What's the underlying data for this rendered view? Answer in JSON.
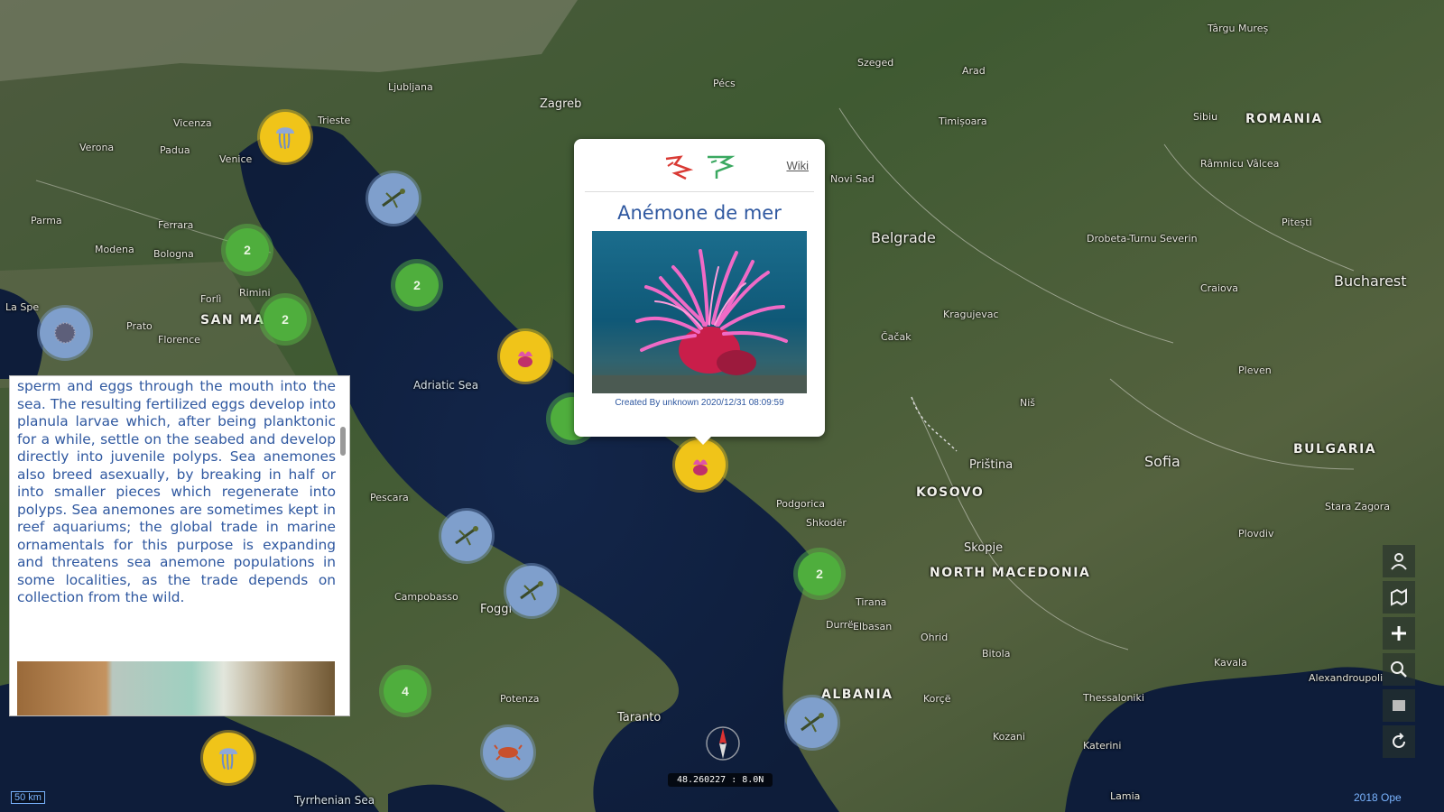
{
  "map": {
    "labels": {
      "countries": [
        "ROMANIA",
        "SAN MA",
        "KOSOVO",
        "NORTH MACEDONIA",
        "BULGARIA",
        "ALBANIA"
      ],
      "seas": [
        "Adriatic Sea",
        "Tyrrhenian Sea"
      ],
      "cities": [
        "Trieste",
        "Ljubljana",
        "Zagreb",
        "Vicenza",
        "Verona",
        "Padua",
        "Venice",
        "Parma",
        "Ferrara",
        "Modena",
        "Bologna",
        "Forlì",
        "Rimini",
        "Prato",
        "Florence",
        "La Spe",
        "Pescara",
        "Campobasso",
        "Foggi",
        "Taranto",
        "Potenza",
        "Durrës",
        "Tirana",
        "Elbasan",
        "Podgorica",
        "Shkodër",
        "Skopje",
        "Priština",
        "Sofia",
        "Belgrade",
        "Novi Sad",
        "Čačak",
        "Kragujevac",
        "Niš",
        "Craiova",
        "Bucharest",
        "Pitești",
        "Stara Zagora",
        "Plovdiv",
        "Kavala",
        "Alexandroupoli",
        "Thessaloniki",
        "Kozani",
        "Katerini",
        "Lamia",
        "Korçë",
        "Ohrid",
        "Bitola",
        "Drobeta-Turnu Severin",
        "Szeged",
        "Arad",
        "Timișoara",
        "Sibiu",
        "Râmnicu Vâlcea",
        "Târgu Mureș",
        "Pleven",
        "Pécs"
      ]
    },
    "clusters": [
      {
        "count": "2"
      },
      {
        "count": "2"
      },
      {
        "count": "2"
      },
      {
        "count": "2"
      },
      {
        "count": "4"
      }
    ],
    "markers": [
      {
        "icon": "jellyfish-icon",
        "color": "#f0c419"
      },
      {
        "icon": "lobster-icon",
        "color": "#7f9fcc"
      },
      {
        "icon": "sea-urchin-icon",
        "color": "#7f9fcc"
      },
      {
        "icon": "anemone-icon",
        "color": "#f0c419"
      },
      {
        "icon": "anemone-icon",
        "color": "#f0c419"
      },
      {
        "icon": "lobster-icon",
        "color": "#7f9fcc"
      },
      {
        "icon": "lobster-icon",
        "color": "#7f9fcc"
      },
      {
        "icon": "lobster-icon",
        "color": "#7f9fcc"
      },
      {
        "icon": "crab-icon",
        "color": "#7f9fcc"
      },
      {
        "icon": "jellyfish-icon",
        "color": "#f0c419"
      }
    ],
    "scale": "50 km",
    "coordinates": "48.260227 : 8.0N",
    "attribution": "2018 Ope"
  },
  "popup": {
    "wiki_label": "Wiki",
    "title": "Anémone de mer",
    "credit": "Created By unknown  2020/12/31 08:09:59"
  },
  "text_panel": {
    "content": "sperm and eggs through the mouth into the sea. The resulting fertilized eggs develop into planula larvae which, after being planktonic for a while, settle on the seabed and develop directly into juvenile polyps. Sea anemones also breed asexually, by breaking in half or into smaller pieces which regenerate into polyps. Sea anemones are sometimes kept in reef aquariums; the global trade in marine ornamentals for this purpose is expanding and threatens sea anemone populations in some localities, as the trade depends on collection from the wild."
  },
  "controls": [
    "user-location-icon",
    "map-style-icon",
    "zoom-in-icon",
    "zoom-search-icon",
    "layers-icon",
    "rotate-icon"
  ],
  "colors": {
    "accent_text": "#2f58a0",
    "cluster_green": "#4fae3d",
    "marker_yellow": "#f0c419",
    "marker_blue": "#7f9fcc"
  }
}
